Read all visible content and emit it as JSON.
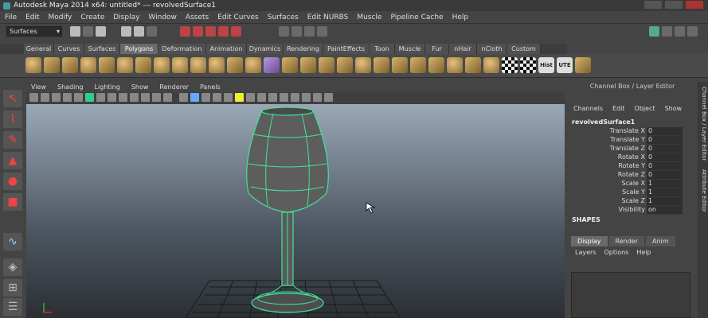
{
  "window": {
    "title": "Autodesk Maya 2014 x64: untitled*   ---   revolvedSurface1"
  },
  "menu": [
    "File",
    "Edit",
    "Modify",
    "Create",
    "Display",
    "Window",
    "Assets",
    "Edit Curves",
    "Surfaces",
    "Edit NURBS",
    "Muscle",
    "Pipeline Cache",
    "Help"
  ],
  "status_line": {
    "mode": "Surfaces"
  },
  "shelf_tabs": [
    "General",
    "Curves",
    "Surfaces",
    "Polygons",
    "Deformation",
    "Animation",
    "Dynamics",
    "Rendering",
    "PaintEffects",
    "Toon",
    "Muscle",
    "Fur",
    "nHair",
    "nCloth",
    "Custom"
  ],
  "active_shelf_tab": "Polygons",
  "shelf_text_icons": {
    "hist": "Hist",
    "ute": "UTE"
  },
  "panel_menu": [
    "View",
    "Shading",
    "Lighting",
    "Show",
    "Renderer",
    "Panels"
  ],
  "channel_box": {
    "header": "Channel Box / Layer Editor",
    "menu": [
      "Channels",
      "Edit",
      "Object",
      "Show"
    ],
    "object": "revolvedSurface1",
    "attributes": [
      {
        "label": "Translate X",
        "value": "0"
      },
      {
        "label": "Translate Y",
        "value": "0"
      },
      {
        "label": "Translate Z",
        "value": "0"
      },
      {
        "label": "Rotate X",
        "value": "0"
      },
      {
        "label": "Rotate Y",
        "value": "0"
      },
      {
        "label": "Rotate Z",
        "value": "0"
      },
      {
        "label": "Scale X",
        "value": "1"
      },
      {
        "label": "Scale Y",
        "value": "1"
      },
      {
        "label": "Scale Z",
        "value": "1"
      },
      {
        "label": "Visibility",
        "value": "on"
      }
    ],
    "shapes_label": "SHAPES"
  },
  "layer_editor": {
    "tabs": [
      "Display",
      "Render",
      "Anim"
    ],
    "active_tab": "Display",
    "menu": [
      "Layers",
      "Options",
      "Help"
    ]
  },
  "side_tabs": [
    "Channel Box / Layer Editor",
    "Attribute Editor"
  ],
  "colors": {
    "wireframe": "#3fe59a",
    "accent": "#b33",
    "panel_bg": "#444444"
  }
}
